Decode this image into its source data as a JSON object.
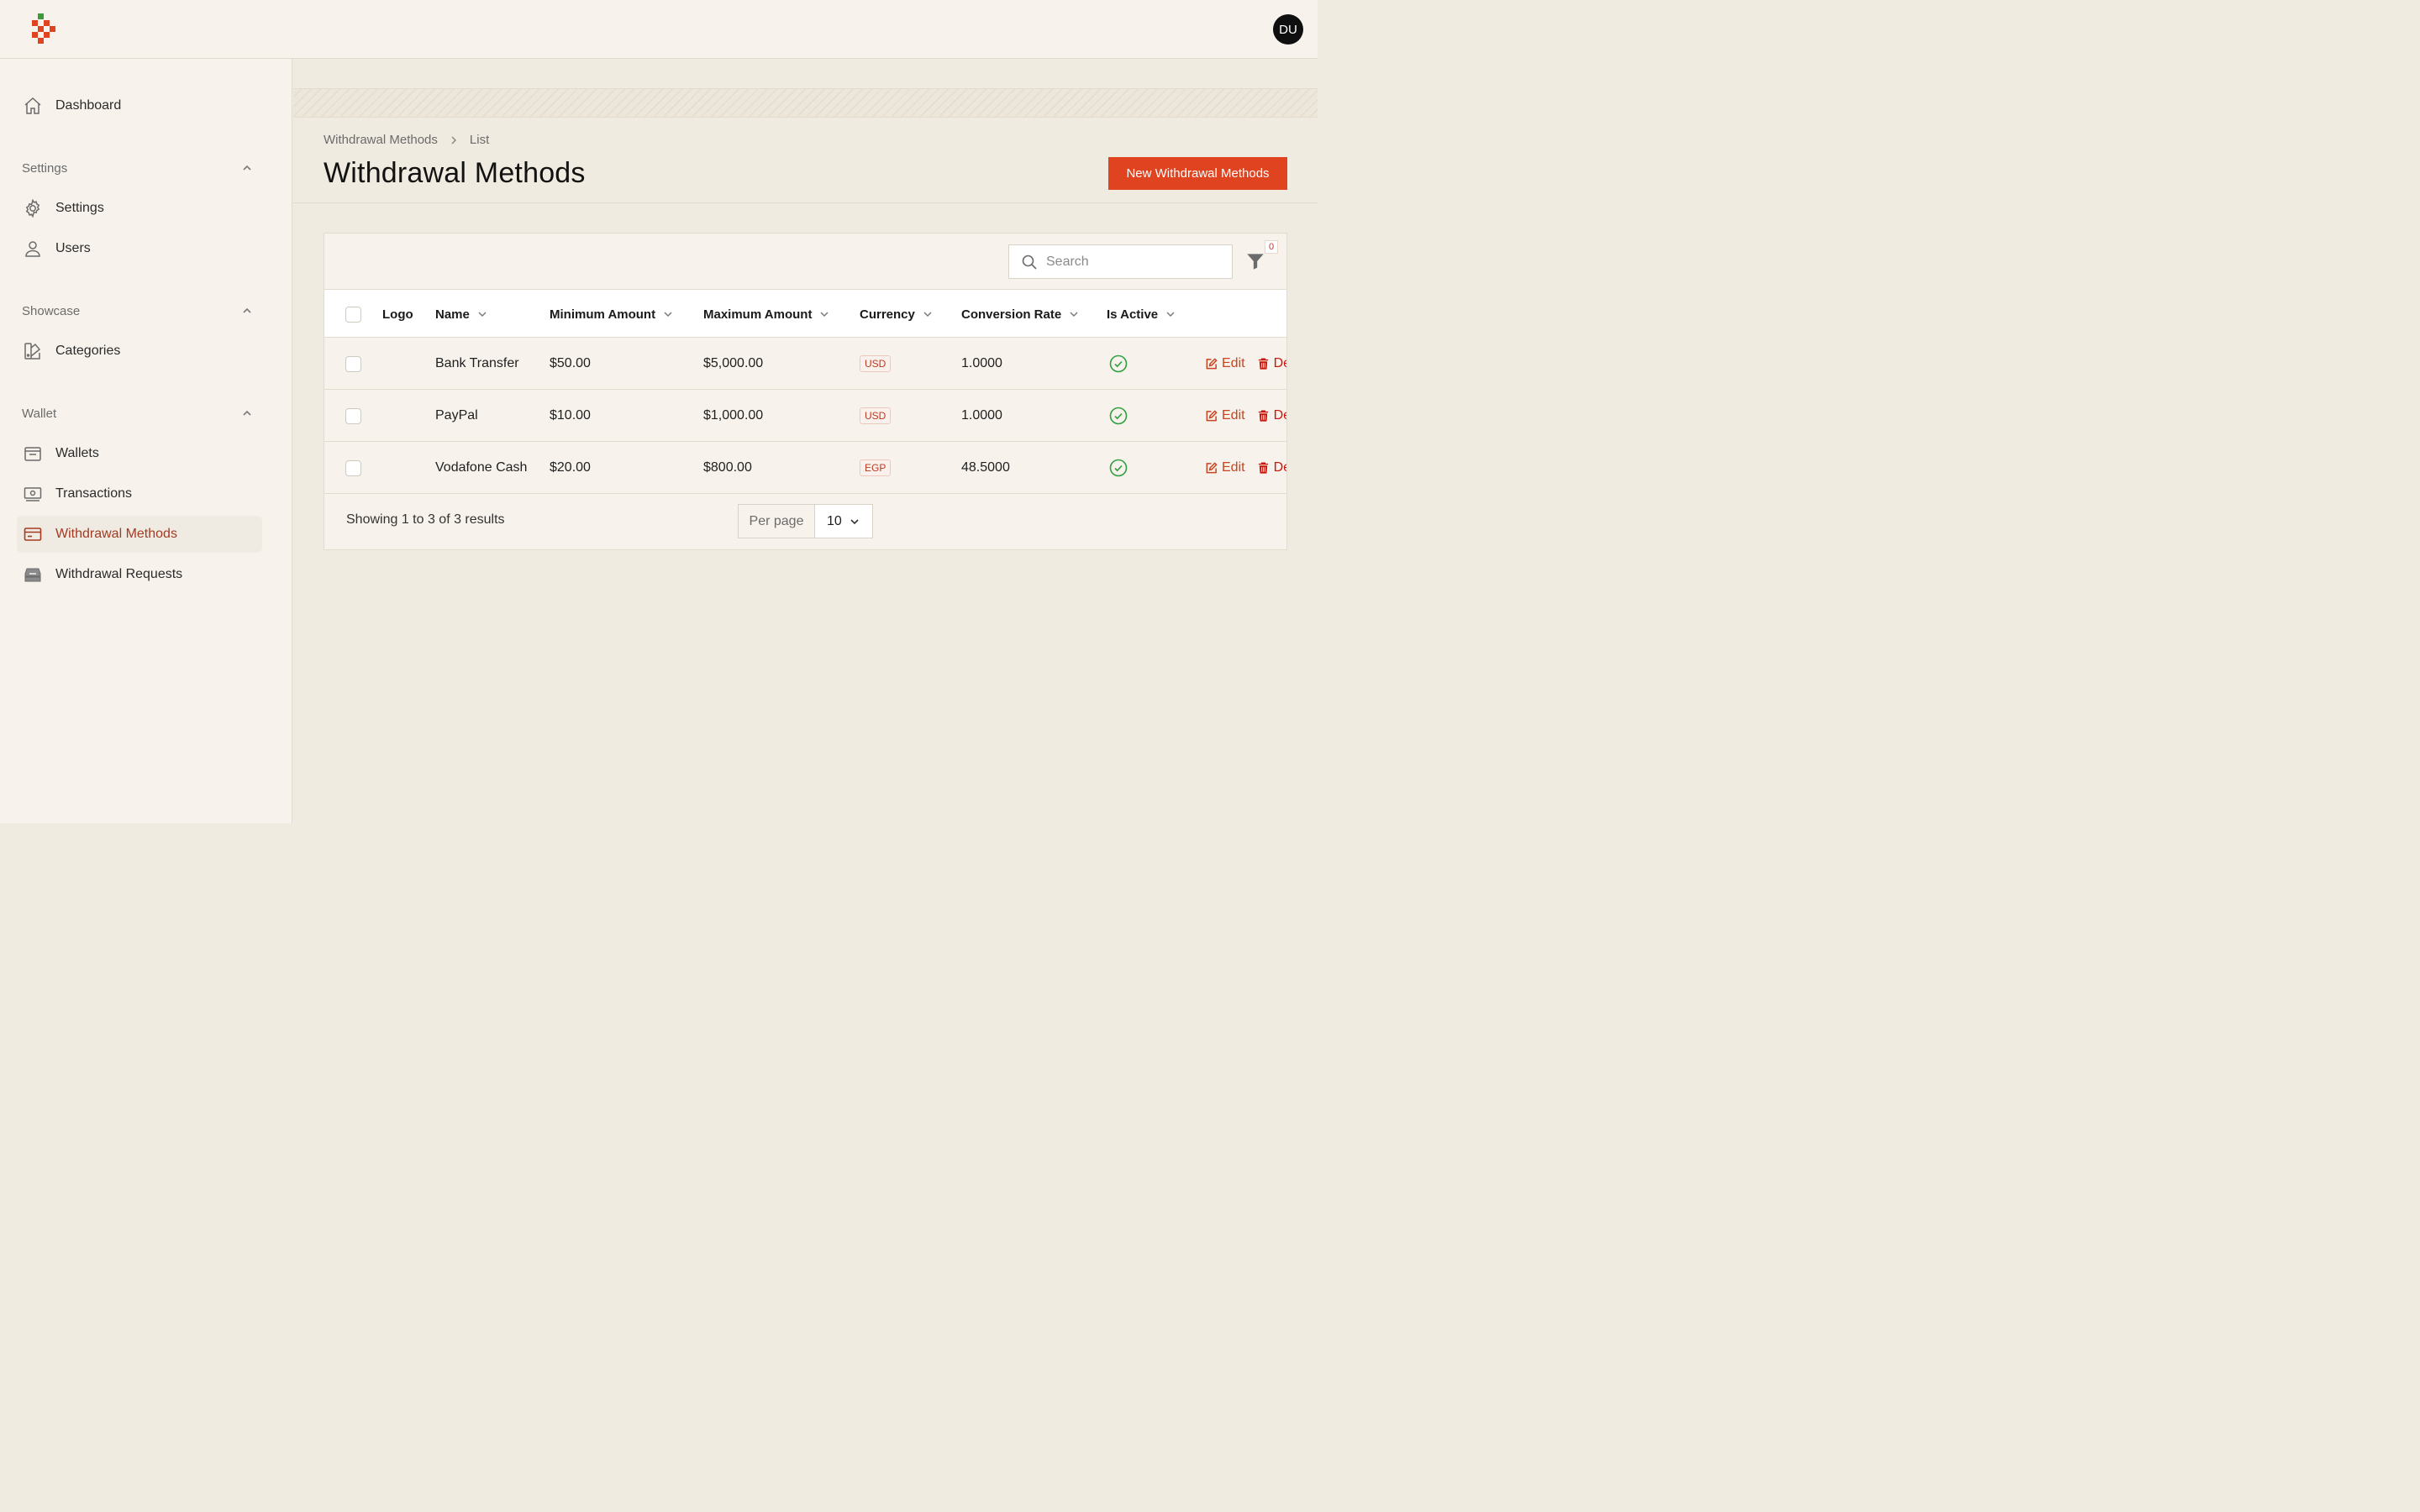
{
  "user": {
    "initials": "DU"
  },
  "sidebar": {
    "dashboard": "Dashboard",
    "groups": {
      "settings": {
        "title": "Settings",
        "items": [
          "Settings",
          "Users"
        ]
      },
      "showcase": {
        "title": "Showcase",
        "items": [
          "Categories"
        ]
      },
      "wallet": {
        "title": "Wallet",
        "items": [
          "Wallets",
          "Transactions",
          "Withdrawal Methods",
          "Withdrawal Requests"
        ]
      }
    },
    "active": "Withdrawal Methods"
  },
  "breadcrumb": {
    "parent": "Withdrawal Methods",
    "current": "List"
  },
  "page": {
    "title": "Withdrawal Methods",
    "new_button": "New Withdrawal Methods"
  },
  "table": {
    "search_placeholder": "Search",
    "filter_count": "0",
    "columns": [
      "Logo",
      "Name",
      "Minimum Amount",
      "Maximum Amount",
      "Currency",
      "Conversion Rate",
      "Is Active"
    ],
    "rows": [
      {
        "name": "Bank Transfer",
        "min": "$50.00",
        "max": "$5,000.00",
        "currency": "USD",
        "rate": "1.0000"
      },
      {
        "name": "PayPal",
        "min": "$10.00",
        "max": "$1,000.00",
        "currency": "USD",
        "rate": "1.0000"
      },
      {
        "name": "Vodafone Cash",
        "min": "$20.00",
        "max": "$800.00",
        "currency": "EGP",
        "rate": "48.5000"
      }
    ],
    "actions": {
      "edit": "Edit",
      "delete": "De"
    },
    "footer": {
      "showing": "Showing 1 to 3 of 3 results",
      "per_page_label": "Per page",
      "per_page_value": "10"
    }
  },
  "colors": {
    "accent": "#e0431f",
    "active_text": "#a33a22",
    "success": "#2e9e3e"
  }
}
